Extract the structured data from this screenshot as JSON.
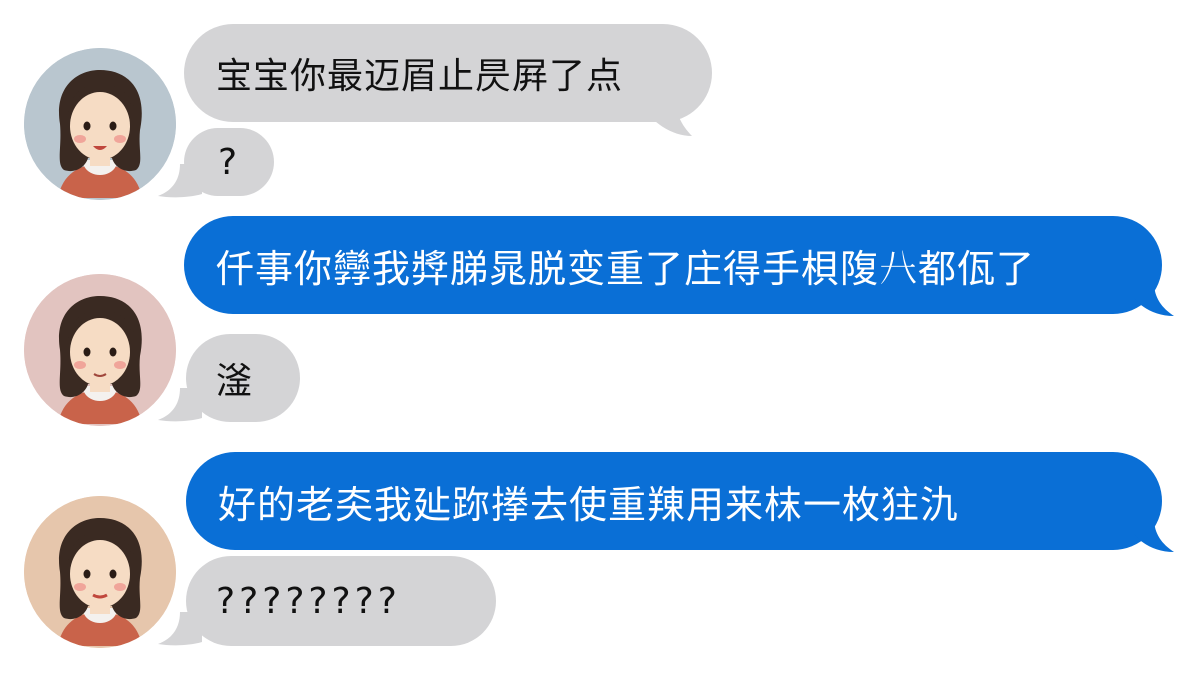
{
  "avatars": [
    {
      "bg": "#b9c6cf"
    },
    {
      "bg": "#e2c4c0"
    },
    {
      "bg": "#e6c6ac"
    }
  ],
  "messages": [
    {
      "text": "宝宝你最迈㞒止昃屛了点"
    },
    {
      "text": "?"
    },
    {
      "text": "仟事你㝈我㢡䏲晁脱变重了庄得手梖䧗𠔀都佤了"
    },
    {
      "text": "滏"
    },
    {
      "text": "好的老㚐我㢟䟢搼去使重䍶用来枺一枚㹥氿"
    },
    {
      "text": "????????"
    }
  ],
  "colors": {
    "incoming_bubble": "#d4d4d6",
    "outgoing_bubble": "#0a6fd6",
    "hair": "#3a2a22",
    "skin": "#f6dcc4",
    "shirt": "#c9634a"
  }
}
